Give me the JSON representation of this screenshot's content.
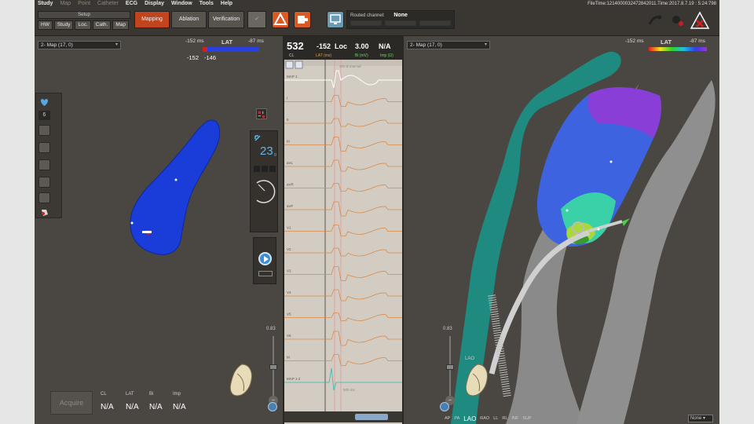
{
  "menu": {
    "items": [
      {
        "label": "Study",
        "enabled": true
      },
      {
        "label": "Map",
        "enabled": false
      },
      {
        "label": "Point",
        "enabled": false
      },
      {
        "label": "Catheter",
        "enabled": false
      },
      {
        "label": "ECG",
        "enabled": true
      },
      {
        "label": "Display",
        "enabled": true
      },
      {
        "label": "Window",
        "enabled": true
      },
      {
        "label": "Tools",
        "enabled": true
      },
      {
        "label": "Help",
        "enabled": true
      }
    ],
    "file_time": "FileTime:1214000032472842011.Time:2017.8.7.19 : 5:24:798"
  },
  "toolbar": {
    "setup_label": "Setup",
    "subtabs": [
      "HW",
      "Study",
      "Loc.",
      "Cath.",
      "Map"
    ],
    "modes": {
      "mapping": "Mapping",
      "ablation": "Ablation",
      "verification": "Verification"
    },
    "routed_channel_label": "Routed channel:",
    "routed_channel_value": "None"
  },
  "left_pane": {
    "map_select": "2- Map (17, 0)",
    "lat": {
      "min": "-152 ms",
      "label": "LAT",
      "max": "-87 ms",
      "value_a": "-152",
      "value_b": "-146"
    },
    "tool_number": "6",
    "counter_big": "23",
    "counter_small": "g",
    "acquire_label": "Acquire",
    "metrics": [
      {
        "key": "CL",
        "value": "N/A"
      },
      {
        "key": "LAT",
        "value": "N/A"
      },
      {
        "key": "Bi",
        "value": "N/A"
      },
      {
        "key": "Imp",
        "value": "N/A"
      }
    ],
    "zoom": "0.83"
  },
  "egm": {
    "cl_value": "532",
    "cl_label": "CL",
    "lat_value": "-152",
    "lat_label": "LAT (ms)",
    "loc_value": "Loc",
    "bi_value": "3.00",
    "bi_label": "Bi (mV)",
    "na_value": "N/A",
    "imp_label": "Imp (Ω)",
    "top_note": "100 B interval",
    "bottom_note": "500 ms",
    "channels": [
      "MAP 1",
      "I",
      "II",
      "III",
      "aVL",
      "aVR",
      "aVF",
      "V1",
      "V2",
      "V3",
      "V4",
      "V5",
      "V6",
      "M",
      "MAP 1-2"
    ]
  },
  "right_pane": {
    "map_select": "2- Map (17, 0)",
    "lat": {
      "min": "-152 ms",
      "label": "LAT",
      "max": "-87 ms"
    },
    "zoom": "0.83",
    "view_label": "LAO",
    "views": [
      "AP",
      "PA",
      "LAO",
      "RAO",
      "LL",
      "RL",
      "INF",
      "SUP"
    ],
    "active_view": "LAO",
    "none_select": "None"
  },
  "colors": {
    "accent": "#c0441e",
    "blue_map": "#1a3cd8",
    "teal_anatomy": "#1f8a80",
    "shell_gray": "#8c8c8c"
  }
}
